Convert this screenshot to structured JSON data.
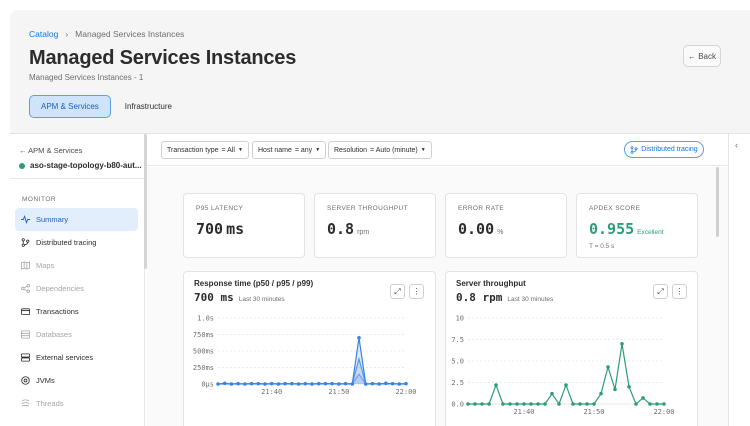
{
  "breadcrumb": {
    "root": "Catalog",
    "separator": "›",
    "current": "Managed Services Instances"
  },
  "page": {
    "title": "Managed Services Instances",
    "subtitle": "Managed Services Instances - 1",
    "back_label": "← Back"
  },
  "tabs": [
    {
      "label": "APM & Services",
      "active": true
    },
    {
      "label": "Infrastructure",
      "active": false
    }
  ],
  "sidebar": {
    "back_label": "← APM & Services",
    "app_name": "aso-stage-topology-b80-aut...",
    "section": "MONITOR",
    "items": [
      {
        "label": "Summary",
        "icon": "pulse-icon",
        "state": "active"
      },
      {
        "label": "Distributed tracing",
        "icon": "tracing-icon",
        "state": "normal"
      },
      {
        "label": "Maps",
        "icon": "map-icon",
        "state": "disabled"
      },
      {
        "label": "Dependencies",
        "icon": "share-icon",
        "state": "disabled"
      },
      {
        "label": "Transactions",
        "icon": "card-icon",
        "state": "normal"
      },
      {
        "label": "Databases",
        "icon": "database-icon",
        "state": "disabled"
      },
      {
        "label": "External services",
        "icon": "server-icon",
        "state": "normal"
      },
      {
        "label": "JVMs",
        "icon": "java-icon",
        "state": "normal"
      },
      {
        "label": "Threads",
        "icon": "threads-icon",
        "state": "disabled"
      }
    ]
  },
  "filters": [
    {
      "label": "Transaction type",
      "value": "= All"
    },
    {
      "label": "Host name",
      "value": "= any"
    },
    {
      "label": "Resolution",
      "value": "= Auto (minute)"
    }
  ],
  "distributed_tracing_button": "Distributed tracing",
  "kpis": [
    {
      "label": "P95 LATENCY",
      "value": "700",
      "unit": "ms",
      "note": ""
    },
    {
      "label": "SERVER THROUGHPUT",
      "value": "0.8",
      "unit": "rpm",
      "note": ""
    },
    {
      "label": "ERROR RATE",
      "value": "0.00",
      "unit": "%",
      "note": ""
    },
    {
      "label": "APDEX SCORE",
      "value": "0.955",
      "unit": "Excellent",
      "note": "T = 0.5 s"
    }
  ],
  "colors": {
    "accent": "#1473e6",
    "good": "#2d9d78",
    "response_line": "#3b82e6",
    "throughput_line": "#2d9d78"
  },
  "chart_data": [
    {
      "type": "line",
      "title": "Response time (p50 / p95 / p99)",
      "headline_value": "700 ms",
      "period": "Last 30 minutes",
      "y_tick_labels": [
        "1.0s",
        "750ms",
        "500ms",
        "250ms",
        "0µs"
      ],
      "x_tick_labels": [
        "21:40",
        "21:50",
        "22:00"
      ],
      "ylim": [
        0,
        1000
      ],
      "x_minutes": [
        0,
        1,
        2,
        3,
        4,
        5,
        6,
        7,
        8,
        9,
        10,
        11,
        12,
        13,
        14,
        15,
        16,
        17,
        18,
        19,
        20,
        21,
        22,
        23,
        24,
        25,
        26,
        27,
        28
      ],
      "series": [
        {
          "values": [
            0,
            10,
            0,
            5,
            0,
            5,
            5,
            0,
            5,
            0,
            5,
            5,
            0,
            5,
            0,
            5,
            5,
            5,
            0,
            5,
            0,
            700,
            0,
            5,
            0,
            10,
            5,
            0,
            5
          ]
        },
        {
          "values": [
            0,
            5,
            0,
            5,
            0,
            5,
            5,
            0,
            5,
            0,
            5,
            5,
            0,
            5,
            0,
            5,
            5,
            5,
            0,
            5,
            0,
            380,
            0,
            5,
            0,
            5,
            5,
            0,
            5
          ]
        },
        {
          "values": [
            0,
            0,
            0,
            0,
            0,
            0,
            0,
            0,
            0,
            0,
            0,
            0,
            0,
            0,
            0,
            0,
            0,
            0,
            0,
            0,
            0,
            150,
            0,
            0,
            0,
            0,
            0,
            0,
            0
          ]
        }
      ]
    },
    {
      "type": "line",
      "title": "Server throughput",
      "headline_value": "0.8 rpm",
      "period": "Last 30 minutes",
      "y_tick_labels": [
        "10",
        "7.5",
        "5.0",
        "2.5",
        "0.0"
      ],
      "x_tick_labels": [
        "21:40",
        "21:50",
        "22:00"
      ],
      "ylim": [
        0,
        10
      ],
      "x_minutes": [
        0,
        1,
        2,
        3,
        4,
        5,
        6,
        7,
        8,
        9,
        10,
        11,
        12,
        13,
        14,
        15,
        16,
        17,
        18,
        19,
        20,
        21,
        22,
        23,
        24,
        25,
        26,
        27,
        28
      ],
      "series": [
        {
          "values": [
            0,
            0,
            0,
            0,
            2.2,
            0,
            0,
            0,
            0,
            0,
            0,
            0,
            1.2,
            0,
            2.2,
            0,
            0,
            0,
            0,
            1.2,
            4.3,
            1.7,
            7.0,
            2.0,
            0,
            0.7,
            0,
            0,
            0
          ]
        }
      ]
    }
  ]
}
